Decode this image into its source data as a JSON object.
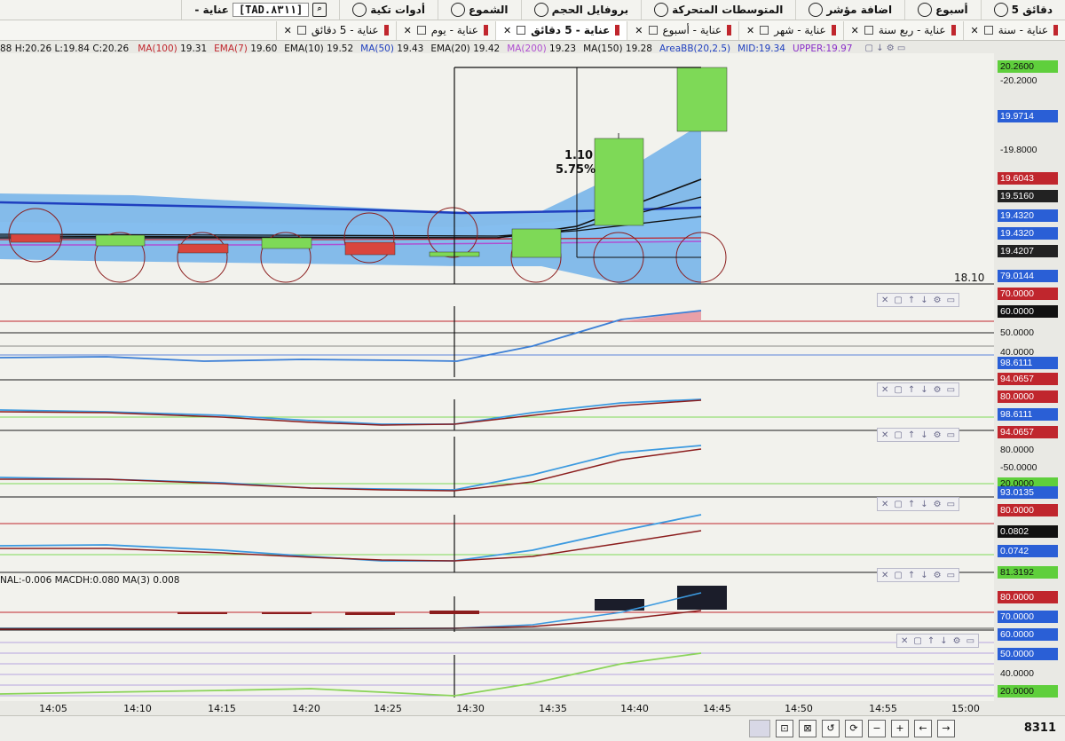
{
  "toolbar": {
    "items": [
      {
        "label": "5 دقائق",
        "icon": "clock-icon"
      },
      {
        "label": "أسبوع",
        "icon": "link-icon"
      },
      {
        "label": "اضافة مؤشر",
        "icon": "indicator-icon"
      },
      {
        "label": "المتوسطات المتحركة",
        "icon": "moving-average-icon"
      },
      {
        "label": "بروفايل الحجم",
        "icon": "volume-profile-icon"
      },
      {
        "label": "الشموع",
        "icon": "candles-icon"
      },
      {
        "label": "أدوات تكية",
        "icon": "tools-icon"
      }
    ],
    "symbol": "[TAD.٨٣١١]",
    "symbol_name": "- عناية",
    "search_icon": "search-icon"
  },
  "tabs": [
    {
      "label": "عناية - سنة",
      "active": false
    },
    {
      "label": "عناية - ربع سنة",
      "active": false
    },
    {
      "label": "عناية - شهر",
      "active": false
    },
    {
      "label": "عناية - أسبوع",
      "active": false
    },
    {
      "label": "عناية - 5 دقائق",
      "active": true
    },
    {
      "label": "عناية - يوم",
      "active": false
    },
    {
      "label": "عناية - 5 دقائق",
      "active": false
    }
  ],
  "infobar": {
    "ohlc": "88  H:20.26  L:19.84  C:20.26",
    "indicators": [
      {
        "label": "MA(100)",
        "value": "19.31",
        "color": "#c0262d"
      },
      {
        "label": "EMA(7)",
        "value": "19.60",
        "color": "#c0262d"
      },
      {
        "label": "EMA(10)",
        "value": "19.52",
        "color": "#111111"
      },
      {
        "label": "MA(50)",
        "value": "19.43",
        "color": "#1f3fbf"
      },
      {
        "label": "EMA(20)",
        "value": "19.42",
        "color": "#111111"
      },
      {
        "label": "MA(200)",
        "value": "19.23",
        "color": "#b04fd1"
      },
      {
        "label": "MA(150)",
        "value": "19.28",
        "color": "#111111"
      },
      {
        "label": "AreaBB(20,2.5)",
        "value": "",
        "color": "#1f3fbf"
      },
      {
        "label": "MID:19.34",
        "value": "",
        "color": "#1f3fbf"
      },
      {
        "label": "UPPER:19.97",
        "value": "",
        "color": "#8b2fc9"
      }
    ]
  },
  "price_labels": [
    {
      "text": "20.2600",
      "bg": "#5fcf3c",
      "color": "#111"
    },
    {
      "text": "-20.2000",
      "bg": "transparent",
      "color": "#111"
    },
    {
      "text": "19.9714",
      "bg": "#2a5fd6",
      "color": "#ffffff"
    },
    {
      "text": "-19.8000",
      "bg": "transparent",
      "color": "#111"
    },
    {
      "text": "19.6043",
      "bg": "#c0262d",
      "color": "#ffffff"
    },
    {
      "text": "19.5160",
      "bg": "#222222",
      "color": "#ffffff"
    },
    {
      "text": "19.4320",
      "bg": "#2a5fd6",
      "color": "#ffffff"
    },
    {
      "text": "19.4320",
      "bg": "#2a5fd6",
      "color": "#ffffff"
    },
    {
      "text": "19.4207",
      "bg": "#222222",
      "color": "#ffffff"
    },
    {
      "text": "79.0144",
      "bg": "#2a5fd6",
      "color": "#ffffff"
    }
  ],
  "annotation": {
    "change": "1.10",
    "percent": "5.75%"
  },
  "last_marker": "18.10",
  "panels": [
    {
      "labels": [
        {
          "text": "70.0000",
          "bg": "#c0262d",
          "color": "#fff"
        },
        {
          "text": "60.0000",
          "bg": "#111",
          "color": "#fff"
        },
        {
          "text": "50.0000",
          "bg": "transparent",
          "color": "#111"
        },
        {
          "text": "40.0000",
          "bg": "transparent",
          "color": "#111"
        },
        {
          "text": "98.6111",
          "bg": "#2a5fd6",
          "color": "#fff"
        }
      ]
    },
    {
      "labels": [
        {
          "text": "94.0657",
          "bg": "#c0262d",
          "color": "#fff"
        },
        {
          "text": "80.0000",
          "bg": "#c0262d",
          "color": "#fff"
        },
        {
          "text": "98.6111",
          "bg": "#2a5fd6",
          "color": "#fff"
        }
      ]
    },
    {
      "labels": [
        {
          "text": "94.0657",
          "bg": "#c0262d",
          "color": "#fff"
        },
        {
          "text": "80.0000",
          "bg": "transparent",
          "color": "#111"
        },
        {
          "text": "-50.0000",
          "bg": "transparent",
          "color": "#111"
        },
        {
          "text": "20.0000",
          "bg": "#5fcf3c",
          "color": "#111"
        },
        {
          "text": "93.0135",
          "bg": "#2a5fd6",
          "color": "#fff"
        }
      ]
    },
    {
      "labels": [
        {
          "text": "80.0000",
          "bg": "#c0262d",
          "color": "#fff"
        },
        {
          "text": "0.0802",
          "bg": "#111",
          "color": "#fff"
        },
        {
          "text": "0.0742",
          "bg": "#2a5fd6",
          "color": "#fff"
        },
        {
          "text": "81.3192",
          "bg": "#5fcf3c",
          "color": "#111"
        }
      ]
    },
    {
      "labels": [
        {
          "text": "80.0000",
          "bg": "#c0262d",
          "color": "#fff"
        },
        {
          "text": "70.0000",
          "bg": "#2a5fd6",
          "color": "#fff"
        },
        {
          "text": "60.0000",
          "bg": "#2a5fd6",
          "color": "#fff"
        },
        {
          "text": "50.0000",
          "bg": "#2a5fd6",
          "color": "#fff"
        },
        {
          "text": "40.0000",
          "bg": "transparent",
          "color": "#111"
        },
        {
          "text": "20.0000",
          "bg": "#5fcf3c",
          "color": "#111"
        }
      ]
    }
  ],
  "macd_text": "NAL:-0.006  MACDH:0.080  MA(3)  0.008",
  "x_ticks": [
    "14:05",
    "14:10",
    "14:15",
    "14:20",
    "14:25",
    "14:30",
    "14:35",
    "14:40",
    "14:45",
    "14:50",
    "14:55",
    "15:00"
  ],
  "bottom": {
    "code": "8311"
  },
  "colors": {
    "bull": "#7ed957",
    "bear": "#d9453d",
    "band": "#5fa8e8",
    "ma50": "#1f3fbf"
  }
}
